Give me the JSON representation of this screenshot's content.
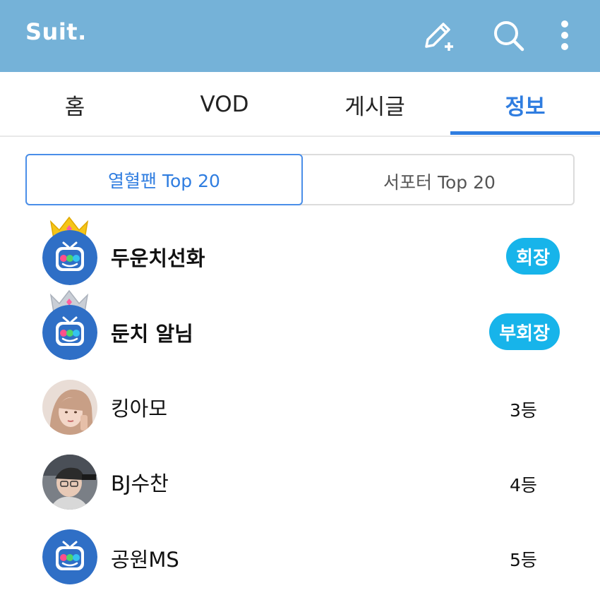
{
  "appbar": {
    "title": "Suit.",
    "icons": [
      "edit-plus-icon",
      "search-icon",
      "more-vertical-icon"
    ]
  },
  "tabs": [
    {
      "label": "홈",
      "active": false
    },
    {
      "label": "VOD",
      "active": false
    },
    {
      "label": "게시글",
      "active": false
    },
    {
      "label": "정보",
      "active": true
    }
  ],
  "segment": {
    "left": "열혈팬 Top 20",
    "right": "서포터 Top 20",
    "selected": "left"
  },
  "fans": [
    {
      "name": "두운치선화",
      "badge": "회장",
      "crown": "gold",
      "avatar": "tv-mascot"
    },
    {
      "name": "둔치 알님",
      "badge": "부회장",
      "crown": "silver",
      "avatar": "tv-mascot"
    },
    {
      "name": "킹아모",
      "rank": "3등",
      "avatar": "photo-woman"
    },
    {
      "name": "BJ수찬",
      "rank": "4등",
      "avatar": "photo-man"
    },
    {
      "name": "공원MS",
      "rank": "5등",
      "avatar": "tv-mascot"
    }
  ],
  "colors": {
    "appbar": "#75b2d8",
    "accent": "#2f7de0",
    "badge": "#17b4ea",
    "mascot": "#2f6fc6"
  }
}
